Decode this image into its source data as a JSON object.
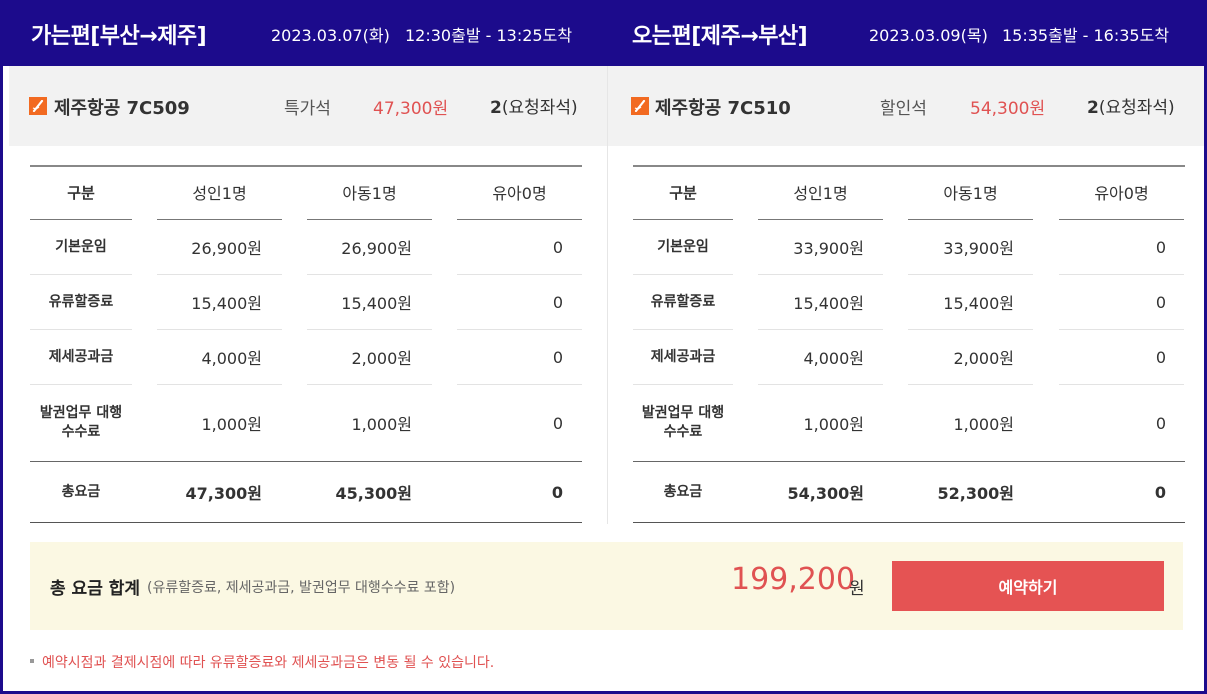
{
  "outbound": {
    "title": "가는편[부산→제주]",
    "date": "2023.03.07(화)",
    "time": "12:30출발 - 13:25도착",
    "airline": "제주항공 7C509",
    "seat_class": "특가석",
    "fare": "47,300원",
    "seats_count": "2",
    "seats_note": "(요청좌석)",
    "table": {
      "headers": [
        "구분",
        "성인1명",
        "아동1명",
        "유아0명"
      ],
      "rows": [
        {
          "label": "기본운임",
          "adult": "26,900원",
          "child": "26,900원",
          "infant": "0"
        },
        {
          "label": "유류할증료",
          "adult": "15,400원",
          "child": "15,400원",
          "infant": "0"
        },
        {
          "label": "제세공과금",
          "adult": "4,000원",
          "child": "2,000원",
          "infant": "0"
        },
        {
          "label": "발권업무 대행 수수료",
          "adult": "1,000원",
          "child": "1,000원",
          "infant": "0"
        }
      ],
      "total": {
        "label": "총요금",
        "adult": "47,300원",
        "child": "45,300원",
        "infant": "0"
      }
    }
  },
  "inbound": {
    "title": "오는편[제주→부산]",
    "date": "2023.03.09(목)",
    "time": "15:35출발 - 16:35도착",
    "airline": "제주항공 7C510",
    "seat_class": "할인석",
    "fare": "54,300원",
    "seats_count": "2",
    "seats_note": "(요청좌석)",
    "table": {
      "headers": [
        "구분",
        "성인1명",
        "아동1명",
        "유아0명"
      ],
      "rows": [
        {
          "label": "기본운임",
          "adult": "33,900원",
          "child": "33,900원",
          "infant": "0"
        },
        {
          "label": "유류할증료",
          "adult": "15,400원",
          "child": "15,400원",
          "infant": "0"
        },
        {
          "label": "제세공과금",
          "adult": "4,000원",
          "child": "2,000원",
          "infant": "0"
        },
        {
          "label": "발권업무 대행 수수료",
          "adult": "1,000원",
          "child": "1,000원",
          "infant": "0"
        }
      ],
      "total": {
        "label": "총요금",
        "adult": "54,300원",
        "child": "52,300원",
        "infant": "0"
      }
    }
  },
  "summary": {
    "title": "총 요금 합계",
    "note": "(유류할증료, 제세공과금, 발권업무 대행수수료 포함)",
    "amount": "199,200",
    "unit": "원",
    "book_label": "예약하기"
  },
  "footnote": "예약시점과 결제시점에 따라 유류할증료와 제세공과금은 변동 될 수 있습니다.",
  "colors": {
    "header_bg": "#1c0b8c",
    "accent_red": "#e55353",
    "airline_orange": "#f26a21",
    "summary_bg": "#fbf8e3"
  },
  "icons": {
    "airline_logo": "jeju-air-logo-icon"
  }
}
